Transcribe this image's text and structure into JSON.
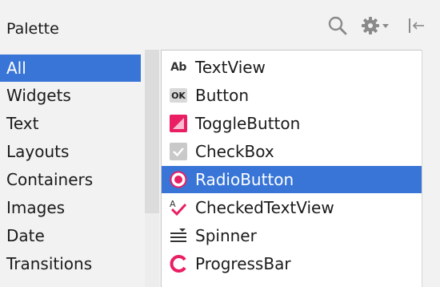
{
  "header": {
    "title": "Palette"
  },
  "categories": [
    {
      "label": "All",
      "selected": true
    },
    {
      "label": "Widgets",
      "selected": false
    },
    {
      "label": "Text",
      "selected": false
    },
    {
      "label": "Layouts",
      "selected": false
    },
    {
      "label": "Containers",
      "selected": false
    },
    {
      "label": "Images",
      "selected": false
    },
    {
      "label": "Date",
      "selected": false
    },
    {
      "label": "Transitions",
      "selected": false
    }
  ],
  "components": [
    {
      "label": "TextView",
      "icon": "textview-icon",
      "icon_text": "Ab",
      "selected": false
    },
    {
      "label": "Button",
      "icon": "button-icon",
      "icon_text": "OK",
      "selected": false
    },
    {
      "label": "ToggleButton",
      "icon": "toggle-button-icon",
      "selected": false
    },
    {
      "label": "CheckBox",
      "icon": "checkbox-icon",
      "selected": false
    },
    {
      "label": "RadioButton",
      "icon": "radio-button-icon",
      "selected": true
    },
    {
      "label": "CheckedTextView",
      "icon": "checked-textview-icon",
      "selected": false
    },
    {
      "label": "Spinner",
      "icon": "spinner-icon",
      "selected": false
    },
    {
      "label": "ProgressBar",
      "icon": "progress-bar-icon",
      "selected": false
    }
  ],
  "colors": {
    "selection": "#3875d7",
    "accent": "#e91e63",
    "background": "#f2f2f2"
  }
}
